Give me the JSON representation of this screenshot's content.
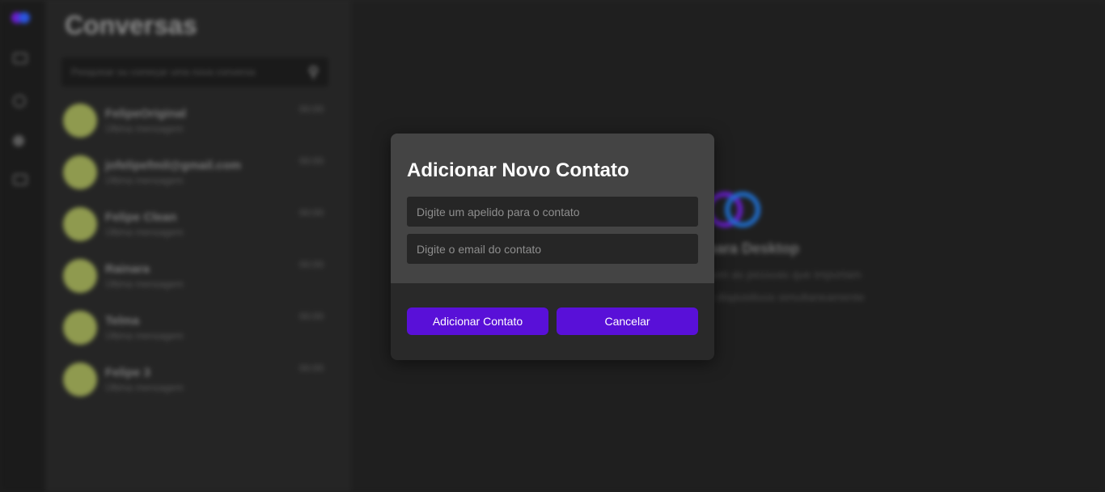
{
  "sidebar": {
    "title": "Conversas",
    "search_placeholder": "Pesquisar ou começar uma nova conversa",
    "chats": [
      {
        "name": "FelipeOriginal",
        "last_message": "Última mensagem",
        "time": "00:00"
      },
      {
        "name": "jofelipefmil@gmail.com",
        "last_message": "Última mensagem",
        "time": "00:00"
      },
      {
        "name": "Felipe Clean",
        "last_message": "Última mensagem",
        "time": "00:00"
      },
      {
        "name": "Rainara",
        "last_message": "Última mensagem",
        "time": "00:00"
      },
      {
        "name": "Telma",
        "last_message": "Última mensagem",
        "time": "00:00"
      },
      {
        "name": "Felipe 3",
        "last_message": "Última mensagem",
        "time": "00:00"
      }
    ]
  },
  "welcome": {
    "title": "para Desktop",
    "line1": "com as pessoas que importam",
    "line2": "o dispositivos simultaneamente"
  },
  "modal": {
    "title": "Adicionar Novo Contato",
    "nickname_placeholder": "Digite um apelido para o contato",
    "email_placeholder": "Digite o email do contato",
    "add_label": "Adicionar Contato",
    "cancel_label": "Cancelar"
  },
  "colors": {
    "accent": "#5910d8",
    "modal_top": "#444444",
    "modal_bottom": "#292929",
    "avatar": "#8f9a4f"
  }
}
